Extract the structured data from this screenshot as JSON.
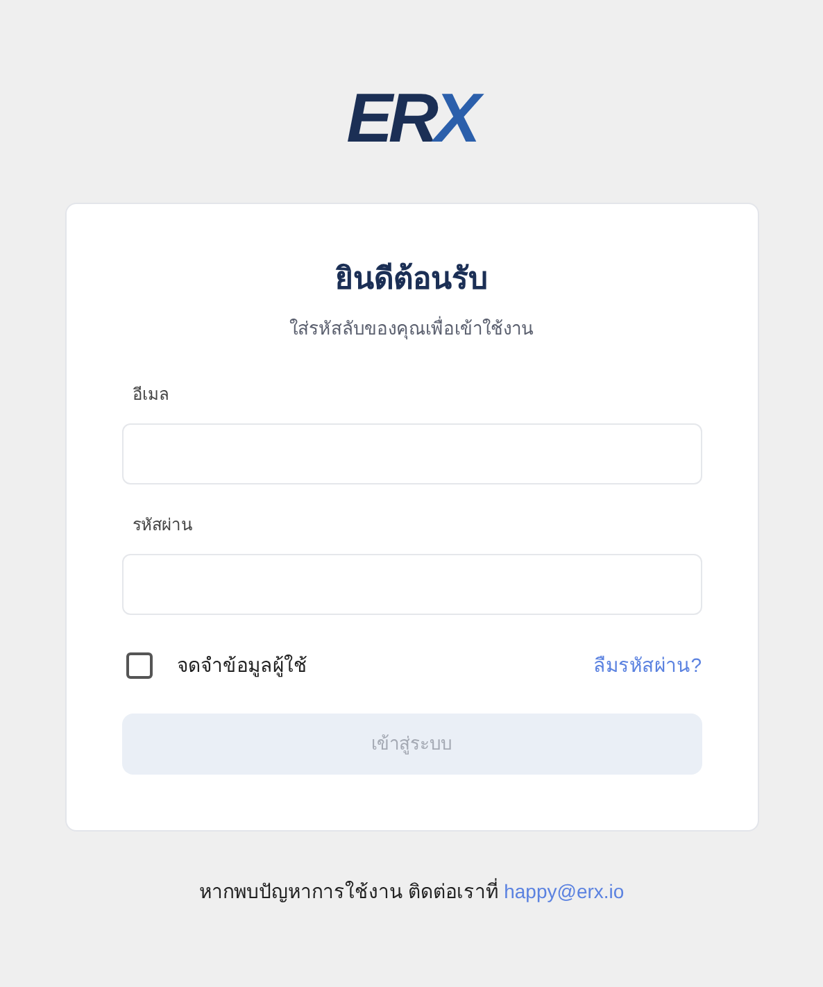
{
  "logo": {
    "parts": [
      {
        "text": "ER",
        "color": "#1b2f55"
      },
      {
        "text": "X",
        "color": "#2b5fab"
      }
    ]
  },
  "card": {
    "title": "ยินดีต้อนรับ",
    "subtitle": "ใส่รหัสลับของคุณเพื่อเข้าใช้งาน",
    "fields": [
      {
        "label": "อีเมล"
      },
      {
        "label": "รหัสผ่าน"
      }
    ],
    "remember": {
      "label": "จดจำข้อมูลผู้ใช้",
      "checked": false
    },
    "forgot_link": "ลืมรหัสผ่าน?",
    "submit": {
      "label": "เข้าสู่ระบบ",
      "disabled": true
    }
  },
  "footer": {
    "text": "หากพบปัญหาการใช้งาน ติดต่อเราที่",
    "link": "happy@erx.io"
  }
}
